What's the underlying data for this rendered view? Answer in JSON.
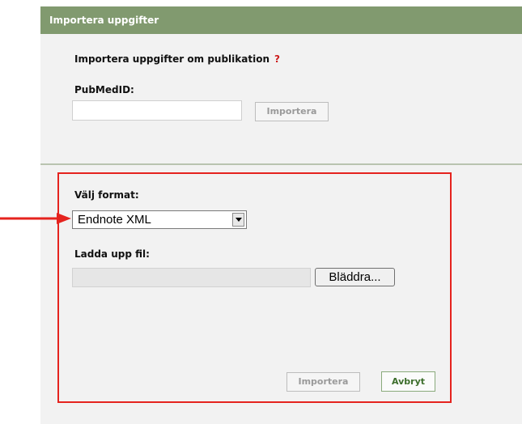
{
  "header": {
    "title": "Importera uppgifter"
  },
  "publication_section": {
    "heading": "Importera uppgifter om publikation",
    "help": "?",
    "pubmed_label": "PubMedID:",
    "pubmed_value": "",
    "import_label": "Importera"
  },
  "file_section": {
    "format_label": "Välj format:",
    "format_selected": "Endnote XML",
    "upload_label": "Ladda upp fil:",
    "file_value": "",
    "browse_label": "Bläddra...",
    "import_label": "Importera",
    "cancel_label": "Avbryt"
  },
  "icons": {
    "format_dropdown": "chevron-down-icon",
    "annotation": "arrow-right-icon"
  },
  "colors": {
    "header": "#819a6f",
    "highlight": "#e5231e",
    "help": "#cc1a1a",
    "cancel_text": "#3d6e2c"
  }
}
